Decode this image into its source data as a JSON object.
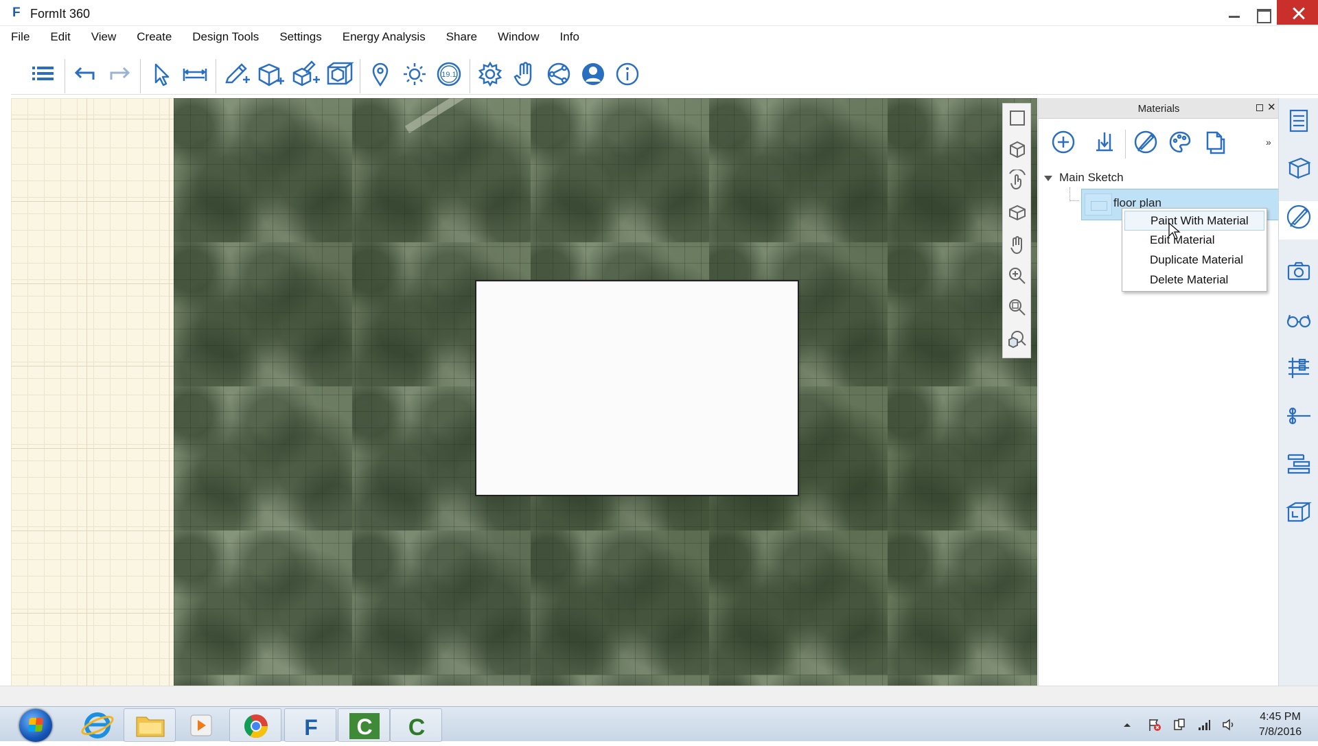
{
  "window": {
    "title": "FormIt 360",
    "logo": "F"
  },
  "menubar": {
    "items": [
      "File",
      "Edit",
      "View",
      "Create",
      "Design Tools",
      "Settings",
      "Energy Analysis",
      "Share",
      "Window",
      "Info"
    ]
  },
  "toolbar": {
    "icons": [
      "list-icon",
      "undo-icon",
      "redo-icon",
      "select-arrow-icon",
      "dimension-icon",
      "sketch-pencil-icon",
      "add-cube-icon",
      "level-cube-icon",
      "group-cube-icon",
      "location-pin-icon",
      "sun-icon",
      "version-badge-icon",
      "gear-icon",
      "gesture-hand-icon",
      "share-icon",
      "user-icon",
      "info-icon"
    ],
    "version_badge": "19.1"
  },
  "navbar": {
    "icons": [
      "zoom-extents-icon",
      "view-cube-icon",
      "orbit-icon",
      "perspective-icon",
      "pan-hand-icon",
      "zoom-icon",
      "zoom-window-icon",
      "zoom-selection-icon"
    ]
  },
  "materials_panel": {
    "title": "Materials",
    "float_icon": "float-panel-icon",
    "close_icon": "close-icon",
    "tools": [
      "add-material-icon",
      "import-material-icon",
      "paint-brush-icon",
      "palette-icon",
      "copy-material-icon"
    ],
    "more": "»",
    "tree": {
      "root_label": "Main Sketch",
      "material_name": "floor plan"
    }
  },
  "context_menu": {
    "items": [
      {
        "label": "Paint With Material",
        "active": true
      },
      {
        "label": "Edit Material",
        "active": false
      },
      {
        "label": "Duplicate Material",
        "active": false
      },
      {
        "label": "Delete Material",
        "active": false
      }
    ]
  },
  "right_strip": {
    "icons": [
      "properties-icon",
      "layers-icon",
      "materials-brush-icon",
      "scenes-camera-icon",
      "visual-style-glasses-icon",
      "levels-icon",
      "groups-icon",
      "layers-stack-icon",
      "content-library-icon"
    ],
    "active": "materials-brush-icon"
  },
  "taskbar": {
    "apps": [
      "start-button",
      "internet-explorer-icon",
      "file-explorer-icon",
      "media-player-icon",
      "chrome-icon",
      "formit-icon",
      "camtasia-recorder-icon",
      "camtasia-studio-icon"
    ],
    "time": "4:45 PM",
    "date": "7/8/2016"
  },
  "colors": {
    "accent_blue": "#1f5ea8",
    "selection_blue": "#bfe1f5",
    "close_red": "#c9302c"
  }
}
